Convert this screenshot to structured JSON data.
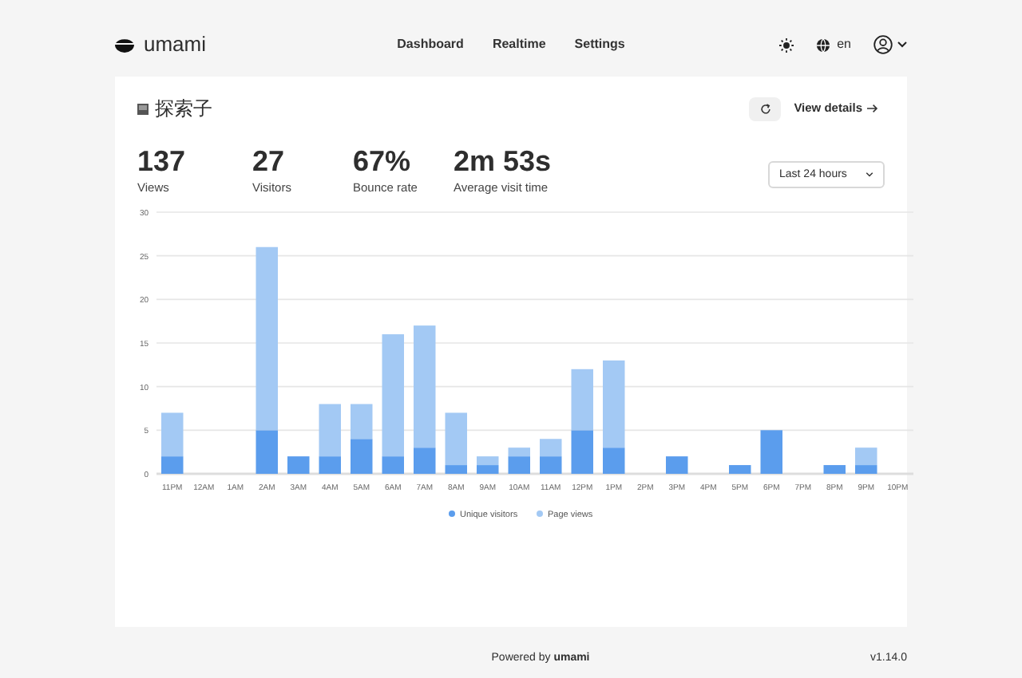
{
  "header": {
    "logo": "umami",
    "nav": [
      {
        "label": "Dashboard",
        "selected": false
      },
      {
        "label": "Realtime",
        "selected": false
      },
      {
        "label": "Settings",
        "selected": false
      }
    ],
    "language": "en"
  },
  "website": {
    "name": "探索子",
    "view_details": "View details"
  },
  "metrics": [
    {
      "value": "137",
      "label": "Views"
    },
    {
      "value": "27",
      "label": "Visitors"
    },
    {
      "value": "67%",
      "label": "Bounce rate"
    },
    {
      "value": "2m 53s",
      "label": "Average visit time"
    }
  ],
  "date_range": "Last 24 hours",
  "chart_data": {
    "type": "bar",
    "stacked": true,
    "categories": [
      "11PM",
      "12AM",
      "1AM",
      "2AM",
      "3AM",
      "4AM",
      "5AM",
      "6AM",
      "7AM",
      "8AM",
      "9AM",
      "10AM",
      "11AM",
      "12PM",
      "1PM",
      "2PM",
      "3PM",
      "4PM",
      "5PM",
      "6PM",
      "7PM",
      "8PM",
      "9PM",
      "10PM"
    ],
    "ylim": [
      0,
      30
    ],
    "yticks": [
      0,
      5,
      10,
      15,
      20,
      25,
      30
    ],
    "grid": true,
    "legend": true,
    "series": [
      {
        "name": "Unique visitors",
        "color": "#5b9ded",
        "values": [
          2,
          0,
          0,
          5,
          2,
          2,
          4,
          2,
          3,
          1,
          1,
          2,
          2,
          5,
          3,
          0,
          2,
          0,
          1,
          5,
          0,
          1,
          1,
          0
        ]
      },
      {
        "name": "Page views",
        "color": "#a3c9f4",
        "values": [
          5,
          0,
          0,
          21,
          0,
          6,
          4,
          14,
          14,
          6,
          1,
          1,
          2,
          7,
          10,
          0,
          0,
          0,
          0,
          0,
          0,
          0,
          2,
          0
        ]
      }
    ]
  },
  "footer": {
    "powered_by": "Powered by **umami**",
    "version": "v1.14.0"
  }
}
